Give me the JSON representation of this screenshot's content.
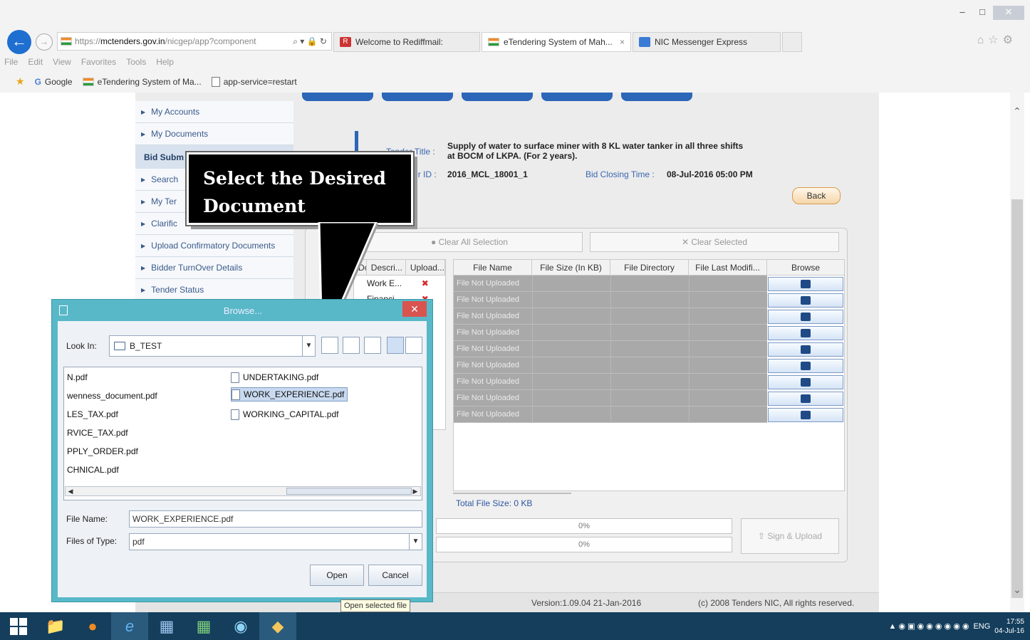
{
  "browser": {
    "url_prefix": "https://",
    "url_host": "mctenders.gov.in",
    "url_path": "/nicgep/app?component",
    "addr_tools": "⌕ ▾ 🔒 ↻",
    "tabs": [
      {
        "label": "Welcome to Rediffmail:",
        "icon": "R"
      },
      {
        "label": "eTendering System of Mah...",
        "icon": ""
      },
      {
        "label": "NIC Messenger Express",
        "icon": ""
      }
    ],
    "tab_close": "×",
    "menu": [
      "File",
      "Edit",
      "View",
      "Favorites",
      "Tools",
      "Help"
    ],
    "favorites": [
      "Google",
      "eTendering System of Ma...",
      "app-service=restart"
    ],
    "window_controls": [
      "–",
      "□",
      "✕"
    ],
    "right_icons": "⌂☆⚙"
  },
  "leftnav": {
    "items_top": [
      "My Accounts",
      "My Documents"
    ],
    "section": "Bid Subm",
    "items": [
      "Search",
      "My Ter",
      "Clarific",
      "Upload Confirmatory Documents",
      "Bidder TurnOver Details",
      "Tender Status"
    ]
  },
  "tender": {
    "title_label": "Tender Title :",
    "title_value_1": "Supply of water to surface miner with 8 KL water tanker in all three shifts",
    "title_value_2": "at BOCM of LKPA. (For 2 years).",
    "id_label": "Tender ID :",
    "id_value": "2016_MCL_18001_1",
    "closing_label": "Bid Closing Time :",
    "closing_value": "08-Jul-2016 05:00 PM",
    "back_label": "Back"
  },
  "upload": {
    "clear_all": "Clear All Selection",
    "clear_selected": "Clear Selected",
    "left_headers": [
      "Docume",
      "Descri...",
      "Upload..."
    ],
    "left_rows": [
      {
        "desc": "Work E...",
        "status": "✖"
      },
      {
        "desc": "Financi...",
        "status": "✖"
      }
    ],
    "headers": [
      "File Name",
      "File Size (In KB)",
      "File Directory",
      "File Last Modifi...",
      "Browse"
    ],
    "row_text": "File Not Uploaded",
    "total": "Total File Size: 0 KB",
    "progress": [
      "0%",
      "0%"
    ],
    "sign_upload": "Sign & Upload",
    "version": "Version:1.09.04 21-Jan-2016",
    "copyright": "(c) 2008 Tenders NIC, All rights reserved."
  },
  "callout": {
    "line1": "Select the Desired",
    "line2": "Document"
  },
  "dialog": {
    "title": "Browse...",
    "close": "✕",
    "look_in_label": "Look In:",
    "look_in_value": "B_TEST",
    "col1": [
      "N.pdf",
      "wenness_document.pdf",
      "LES_TAX.pdf",
      "RVICE_TAX.pdf",
      "PPLY_ORDER.pdf",
      "CHNICAL.pdf"
    ],
    "col2": [
      "UNDERTAKING.pdf",
      "WORK_EXPERIENCE.pdf",
      "WORKING_CAPITAL.pdf"
    ],
    "selected_file": "WORK_EXPERIENCE.pdf",
    "file_name_label": "File Name:",
    "file_name_value": "WORK_EXPERIENCE.pdf",
    "files_type_label": "Files of Type:",
    "files_type_value": "pdf",
    "open": "Open",
    "cancel": "Cancel",
    "tooltip": "Open selected file"
  },
  "taskbar": {
    "lang": "ENG",
    "time": "17:55",
    "date": "04-Jul-16"
  },
  "colors": {
    "accent": "#2c66b8",
    "dialog_frame": "#58b8c8",
    "taskbar": "#143e5c",
    "not_uploaded": "#a9a9a9"
  }
}
